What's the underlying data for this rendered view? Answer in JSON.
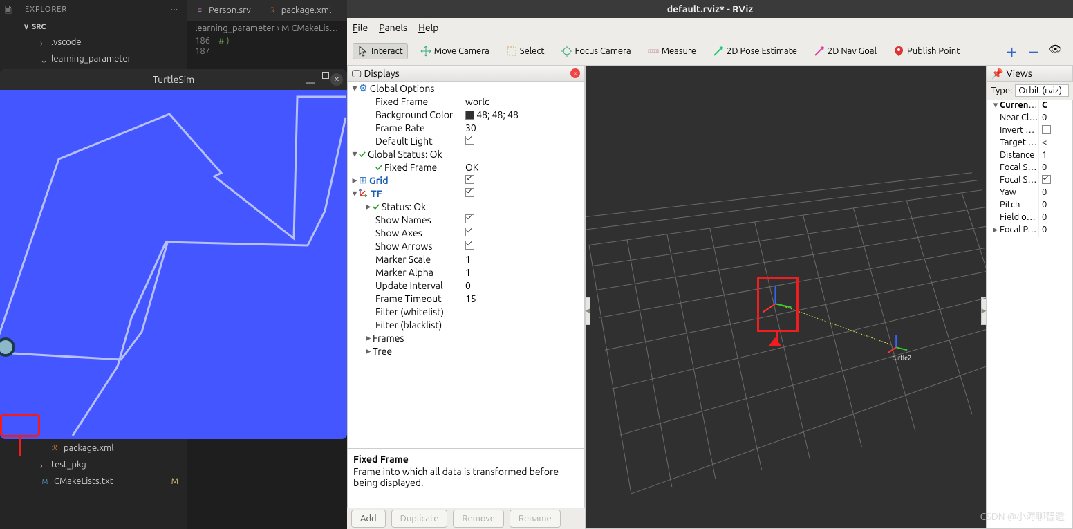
{
  "vscode": {
    "explorer_title": "EXPLORER",
    "src_label": "SRC",
    "tree": {
      "vscode_folder": ".vscode",
      "learning_parameter": "learning_parameter",
      "package_xml": "package.xml",
      "test_pkg": "test_pkg",
      "cmake": "CMakeLists.txt"
    },
    "tabs": {
      "person": "Person.srv",
      "package": "package.xml"
    },
    "breadcrumb": "learning_parameter › M CMakeLis…",
    "code": {
      "l186_no": "186",
      "l186": "# )",
      "l187_no": "187",
      "l187": ""
    }
  },
  "turtlesim": {
    "title": "TurtleSim"
  },
  "rviz": {
    "title": "default.rviz* - RViz",
    "menu": {
      "file": "File",
      "panels": "Panels",
      "help": "Help"
    },
    "toolbar": {
      "interact": "Interact",
      "move": "Move Camera",
      "select": "Select",
      "focus": "Focus Camera",
      "measure": "Measure",
      "pose2d": "2D Pose Estimate",
      "nav2d": "2D Nav Goal",
      "publish": "Publish Point"
    },
    "displays": {
      "header": "Displays",
      "global_options": "Global Options",
      "fixed_frame": "Fixed Frame",
      "fixed_frame_v": "world",
      "bg_color": "Background Color",
      "bg_color_v": "48; 48; 48",
      "frame_rate": "Frame Rate",
      "frame_rate_v": "30",
      "default_light": "Default Light",
      "global_status": "Global Status: Ok",
      "fixed_frame2": "Fixed Frame",
      "fixed_frame2_v": "OK",
      "grid": "Grid",
      "tf": "TF",
      "status_ok": "Status: Ok",
      "show_names": "Show Names",
      "show_axes": "Show Axes",
      "show_arrows": "Show Arrows",
      "marker_scale": "Marker Scale",
      "marker_scale_v": "1",
      "marker_alpha": "Marker Alpha",
      "marker_alpha_v": "1",
      "update_int": "Update Interval",
      "update_int_v": "0",
      "frame_timeout": "Frame Timeout",
      "frame_timeout_v": "15",
      "filter_w": "Filter (whitelist)",
      "filter_b": "Filter (blacklist)",
      "frames": "Frames",
      "tree_l": "Tree",
      "desc_title": "Fixed Frame",
      "desc_text": "Frame into which all data is transformed before being displayed.",
      "btn_add": "Add",
      "btn_dup": "Duplicate",
      "btn_rem": "Remove",
      "btn_ren": "Rename"
    },
    "views": {
      "header": "Views",
      "type_l": "Type:",
      "type_v": "Orbit (rviz)",
      "current": "Current V…",
      "near": "Near Cl…",
      "near_v": "0",
      "invert": "Invert …",
      "target": "Target …",
      "target_v": "<",
      "distance": "Distance",
      "distance_v": "1",
      "focalsh": "Focal S…",
      "focalsh_v": "0",
      "focalfx": "Focal S…",
      "yaw": "Yaw",
      "yaw_v": "0",
      "pitch": "Pitch",
      "pitch_v": "0",
      "field": "Field o…",
      "field_v": "0",
      "focalp": "Focal P…",
      "focalp_v": "0"
    },
    "tf_label": "turtle2"
  },
  "watermark": "CSDN @小海聊智造"
}
